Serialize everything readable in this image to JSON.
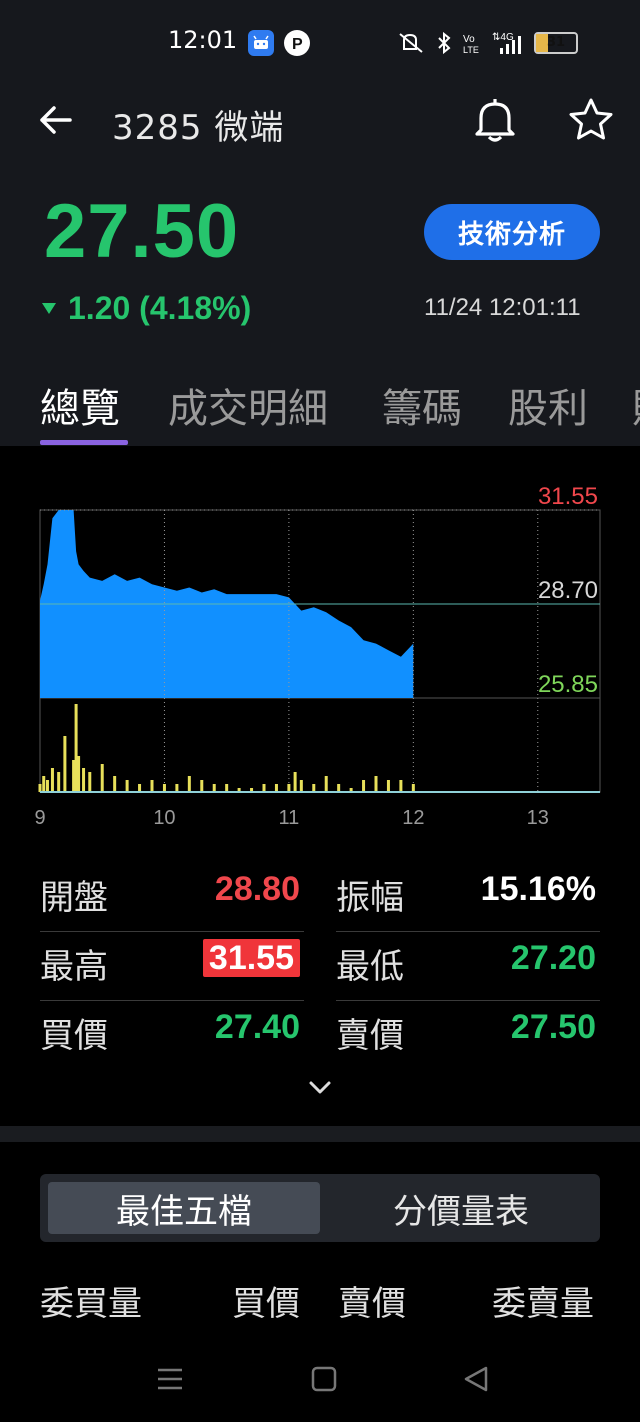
{
  "status_bar": {
    "time": "12:01",
    "battery": "31",
    "battery_level": 0.31,
    "icons": [
      "android-app-icon",
      "parking-app-icon",
      "mute-icon",
      "bluetooth-icon",
      "volte-icon",
      "signal-4g-icon",
      "battery-icon"
    ]
  },
  "header": {
    "title": "3285 微端",
    "price": "27.50",
    "change": "1.20 (4.18%)",
    "tech_button": "技術分析",
    "timestamp": "11/24 12:01:11"
  },
  "tabs": [
    "總覽",
    "成交明細",
    "籌碼",
    "股利",
    "財"
  ],
  "chart_data": {
    "type": "area",
    "x_ticks": [
      "9",
      "10",
      "11",
      "12",
      "13"
    ],
    "y_ticks": [
      "31.55",
      "28.70",
      "25.85"
    ],
    "ylim": [
      25.85,
      31.55
    ],
    "reference": 28.7,
    "colors": {
      "area": "#1190ff",
      "volume": "#e8e05a",
      "high_label": "#f0474c",
      "ref_label": "#d8d8d8",
      "low_label": "#7fd65a"
    },
    "x": [
      9.0,
      9.03,
      9.06,
      9.1,
      9.15,
      9.2,
      9.27,
      9.29,
      9.31,
      9.35,
      9.4,
      9.5,
      9.6,
      9.7,
      9.8,
      9.9,
      10.0,
      10.1,
      10.2,
      10.3,
      10.4,
      10.5,
      10.6,
      10.7,
      10.8,
      10.9,
      11.0,
      11.05,
      11.1,
      11.2,
      11.3,
      11.4,
      11.5,
      11.6,
      11.7,
      11.8,
      11.9,
      12.0
    ],
    "price": [
      28.8,
      29.3,
      29.9,
      31.3,
      31.55,
      31.55,
      31.55,
      30.3,
      29.9,
      29.7,
      29.5,
      29.4,
      29.6,
      29.4,
      29.5,
      29.3,
      29.2,
      29.1,
      29.2,
      29.05,
      29.15,
      29.0,
      29.0,
      29.0,
      29.0,
      29.0,
      28.9,
      28.7,
      28.5,
      28.6,
      28.45,
      28.2,
      28.0,
      27.6,
      27.5,
      27.3,
      27.1,
      27.5
    ],
    "volume": [
      2,
      4,
      3,
      6,
      5,
      14,
      8,
      22,
      9,
      6,
      5,
      7,
      4,
      3,
      2,
      3,
      2,
      2,
      4,
      3,
      2,
      2,
      1,
      1,
      2,
      2,
      2,
      5,
      3,
      2,
      4,
      2,
      1,
      3,
      4,
      3,
      3,
      2
    ]
  },
  "stats": [
    {
      "label": "開盤",
      "value": "28.80",
      "color": "#f0474c",
      "label2": "振幅",
      "value2": "15.16%",
      "color2": "#ffffff"
    },
    {
      "label": "最高",
      "value": "31.55",
      "color": "#ffffff",
      "label2": "最低",
      "value2": "27.20",
      "color2": "#26c56d"
    },
    {
      "label": "買價",
      "value": "27.40",
      "color": "#26c56d",
      "label2": "賣價",
      "value2": "27.50",
      "color2": "#26c56d"
    }
  ],
  "segment": {
    "a": "最佳五檔",
    "b": "分價量表"
  },
  "orderbook_headers": [
    "委買量",
    "買價",
    "賣價",
    "委賣量"
  ]
}
